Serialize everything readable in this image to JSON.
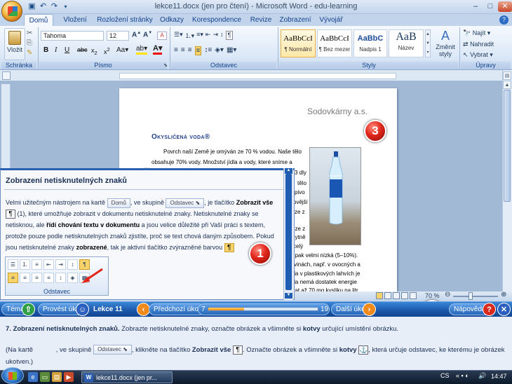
{
  "window": {
    "title": "lekce11.docx (jen pro čtení) - Microsoft Word - edu-learning"
  },
  "tabs": [
    "Domů",
    "Vložení",
    "Rozložení stránky",
    "Odkazy",
    "Korespondence",
    "Revize",
    "Zobrazení",
    "Vývojář"
  ],
  "ribbon": {
    "groups": {
      "clipboard": "Schránka",
      "font": "Písmo",
      "paragraph": "Odstavec",
      "styles": "Styly",
      "editing": "Úpravy"
    },
    "paste_label": "Vložit",
    "font_name": "Tahoma",
    "font_size": "12",
    "styles": [
      {
        "preview": "AaBbCcI",
        "name": "¶ Normální"
      },
      {
        "preview": "AaBbCcI",
        "name": "¶ Bez mezer"
      },
      {
        "preview": "AaBbC",
        "name": "Nadpis 1"
      },
      {
        "preview": "AaB",
        "name": "Název"
      }
    ],
    "change_styles": "Změnit\nstyly",
    "editing": {
      "find": "Najít",
      "replace": "Nahradit",
      "select": "Vybrat"
    }
  },
  "document": {
    "company": "Sodovkárny a.s.",
    "heading": "Okysličená voda®",
    "lines": [
      "Povrch naší Země je omýván ze 70 % vodou. Naše tělo",
      "obsahuje 70% vody. Množství jídla a vody, které sníme a",
      "3 dly",
      "tělo",
      "pivo",
      "ovější",
      "ze z",
      "ůze z",
      "bytně",
      "celý",
      "je pak velmi nízká (5–10%).",
      "ravinách, např. v ovocných a",
      "oda v plastikových lahvích je",
      "oda nemá dostatek energie",
      "ovat až 70 mg kyslíku na litr"
    ],
    "bottle_label": "Okysličená"
  },
  "help": {
    "title": "Zobrazení netisknutelných znaků",
    "p_start": "Velmi užitečným nástrojem na kartě",
    "chip_home": "Domů",
    "p_mid1": ", ve skupině",
    "chip_par": "Odstavec",
    "p_mid2": ", je tlačítko",
    "btn_name": "Zobrazit vše",
    "p_mid3": "(1), které umožňuje zobrazit v dokumentu netisknutelné znaky. Netisknutelné znaky se netisknou, ale",
    "bold_role": "řídí chování textu v dokumentu",
    "p_mid4": "a jsou velice důležité při Vaší práci s textem, protože pouze podle netisknutelných znaků zjistíte, proč se text chová daným způsobem. Pokud jsou netisknutelné znaky",
    "bold_shown": "zobrazené",
    "p_end": ", tak je aktivní tlačítko zvýrazněné barvou",
    "pilcrow": "¶",
    "snippet_label": "Odstavec"
  },
  "callouts": [
    "1",
    "2",
    "3",
    "4"
  ],
  "status": {
    "zoom": "70 %"
  },
  "nav": {
    "theme": "Téma",
    "run_task": "Provést úkol",
    "lesson": "Lekce 11",
    "prev_task": "Předchozí úkol",
    "current": "7",
    "total": "19",
    "progress": 0.33,
    "next_task": "Další úkol",
    "help": "Nápověda"
  },
  "instructions": {
    "task_num": "7.",
    "task_title": "Zobrazení netisknutelných znaků.",
    "task_text": "Zobrazte netisknutelné znaky, označte obrázek a všimněte si",
    "task_bold": "kotvy",
    "task_end": "určující umístění obrázku.",
    "step_start": "(Na kartě",
    "step_mid1": ", ve skupině",
    "chip_par": "Odstavec",
    "step_mid2": ", klikněte na tlačítko",
    "btn_name": "Zobrazit vše",
    "step_mid3": ". Označte obrázek a všimněte si",
    "bold_anchor": "kotvy",
    "step_end": ", která určuje odstavec, ke kterému je obrázek ukotven.)"
  },
  "taskbar": {
    "window": "lekce11.docx (jen pr...",
    "lang": "CS",
    "time": "14:47"
  },
  "colors": {
    "accent": "#1a56a8",
    "callout": "#e1261c"
  }
}
